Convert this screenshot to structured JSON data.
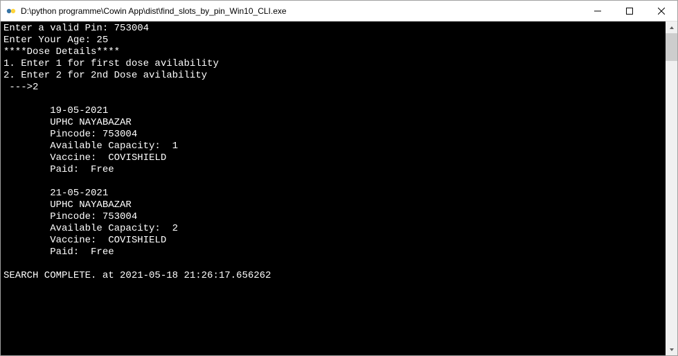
{
  "window": {
    "title": "D:\\python programme\\Cowin App\\dist\\find_slots_by_pin_Win10_CLI.exe"
  },
  "console": {
    "pin_prompt": "Enter a valid Pin: ",
    "pin_value": "753004",
    "age_prompt": "Enter Your Age: ",
    "age_value": "25",
    "dose_header": "****Dose Details****",
    "opt1": "1. Enter 1 for first dose avilability",
    "opt2": "2. Enter 2 for 2nd Dose avilability",
    "arrow": " --->",
    "choice": "2",
    "slots": [
      {
        "date": "19-05-2021",
        "center": "UPHC NAYABAZAR",
        "pincode_label": "Pincode: ",
        "pincode": "753004",
        "capacity_label": "Available Capacity:  ",
        "capacity": "1",
        "vaccine_label": "Vaccine:  ",
        "vaccine": "COVISHIELD",
        "paid_label": "Paid:  ",
        "paid": "Free"
      },
      {
        "date": "21-05-2021",
        "center": "UPHC NAYABAZAR",
        "pincode_label": "Pincode: ",
        "pincode": "753004",
        "capacity_label": "Available Capacity:  ",
        "capacity": "2",
        "vaccine_label": "Vaccine:  ",
        "vaccine": "COVISHIELD",
        "paid_label": "Paid:  ",
        "paid": "Free"
      }
    ],
    "complete": "SEARCH COMPLETE. at 2021-05-18 21:26:17.656262"
  }
}
